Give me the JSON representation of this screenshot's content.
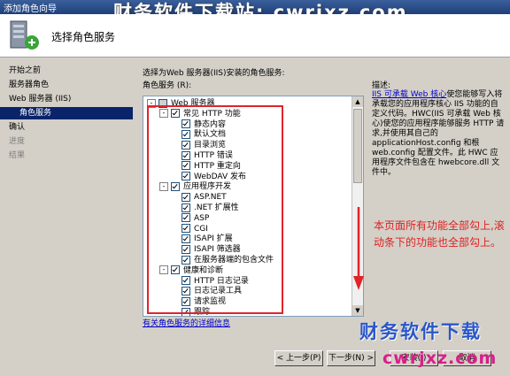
{
  "window": {
    "title": "添加角色向导",
    "watermark": "财务软件下载站: cwrjxz.com"
  },
  "header": {
    "title": "选择角色服务"
  },
  "nav": {
    "items": [
      "开始之前",
      "服务器角色",
      "Web 服务器 (IIS)",
      "角色服务",
      "确认",
      "进度",
      "结果"
    ]
  },
  "main": {
    "instruction": "选择为Web 服务器(IIS)安装的角色服务:",
    "tree_label": "角色服务 (R):",
    "desc_label": "描述:",
    "tree": [
      {
        "text": "Web 服务器",
        "level": 0,
        "expand": "-",
        "checked": "grey"
      },
      {
        "text": "常见 HTTP 功能",
        "level": 1,
        "expand": "-",
        "checked": "on"
      },
      {
        "text": "静态内容",
        "level": 2,
        "checked": "on"
      },
      {
        "text": "默认文档",
        "level": 2,
        "checked": "on"
      },
      {
        "text": "目录浏览",
        "level": 2,
        "checked": "on"
      },
      {
        "text": "HTTP 错误",
        "level": 2,
        "checked": "on"
      },
      {
        "text": "HTTP 重定向",
        "level": 2,
        "checked": "on"
      },
      {
        "text": "WebDAV 发布",
        "level": 2,
        "checked": "on"
      },
      {
        "text": "应用程序开发",
        "level": 1,
        "expand": "-",
        "checked": "on"
      },
      {
        "text": "ASP.NET",
        "level": 2,
        "checked": "on"
      },
      {
        "text": ".NET 扩展性",
        "level": 2,
        "checked": "on"
      },
      {
        "text": "ASP",
        "level": 2,
        "checked": "on"
      },
      {
        "text": "CGI",
        "level": 2,
        "checked": "on"
      },
      {
        "text": "ISAPI 扩展",
        "level": 2,
        "checked": "on"
      },
      {
        "text": "ISAPI 筛选器",
        "level": 2,
        "checked": "on"
      },
      {
        "text": "在服务器端的包含文件",
        "level": 2,
        "checked": "on"
      },
      {
        "text": "健康和诊断",
        "level": 1,
        "expand": "-",
        "checked": "on"
      },
      {
        "text": "HTTP 日志记录",
        "level": 2,
        "checked": "on"
      },
      {
        "text": "日志记录工具",
        "level": 2,
        "checked": "on"
      },
      {
        "text": "请求监视",
        "level": 2,
        "checked": "on"
      },
      {
        "text": "跟踪",
        "level": 2,
        "checked": "on"
      }
    ],
    "description_link": "IIS 可承载 Web 核心",
    "description": "使您能够写入将承载您的应用程序核心 IIS 功能的自定义代码。HWC(IIS 可承载 Web 核心)使您的应用程序能够服务 HTTP 请求,并使用其自己的 applicationHost.config 和根 web.config 配置文件。此 HWC 应用程序文件包含在 hwebcore.dll 文件中。",
    "note": "本页面所有功能全部勾上,滚动条下的功能也全部勾上。",
    "more_link": "有关角色服务的详细信息"
  },
  "buttons": {
    "prev": "< 上一步(P)",
    "next": "下一步(N) >",
    "install": "安装(I)",
    "cancel": "取消"
  },
  "watermark_logo": {
    "text": "财务软件下载",
    "site": "cwrjxz.com"
  }
}
